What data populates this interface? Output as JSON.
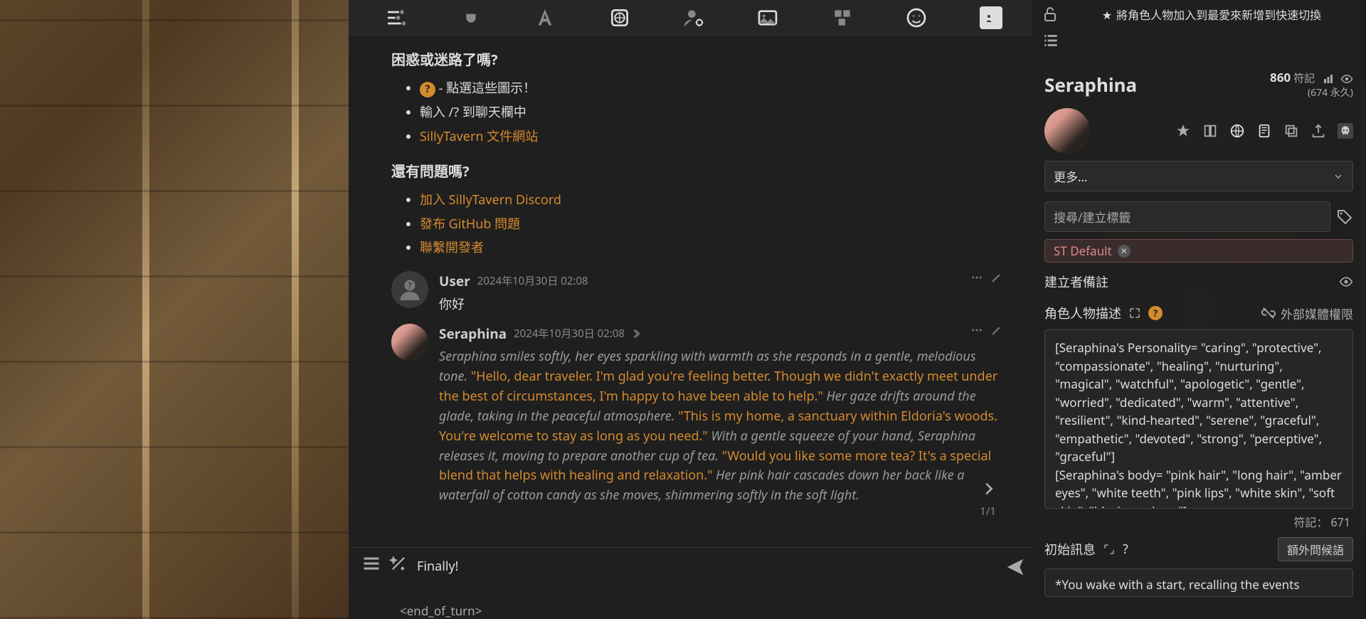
{
  "help": {
    "h1": "困惑或迷路了嗎?",
    "bullet1_suffix": " - 點選這些圖示！",
    "bullet2": "輸入 /? 到聊天欄中",
    "bullet3_link": "SillyTavern 文件網站",
    "h2": "還有問題嗎?",
    "link1": "加入 SillyTavern Discord",
    "link2": "發布 GitHub 問題",
    "link3": "聯繫開發者"
  },
  "msg_user": {
    "name": "User",
    "time": "2024年10月30日 02:08",
    "text": "你好"
  },
  "msg_char": {
    "name": "Seraphina",
    "time": "2024年10月30日 02:08",
    "swipe": "1/1",
    "n1": "Seraphina smiles softly, her eyes sparkling with warmth as she responds in a gentle, melodious tone.",
    "q1": "\"Hello, dear traveler. I'm glad you're feeling better. Though we didn't exactly meet under the best of circumstances, I'm happy to have been able to help.\"",
    "n2": "Her gaze drifts around the glade, taking in the peaceful atmosphere.",
    "q2": "\"This is my home, a sanctuary within Eldoria's woods. You're welcome to stay as long as you need.\"",
    "n3": "With a gentle squeeze of your hand, Seraphina releases it, moving to prepare another cup of tea.",
    "q3": "\"Would you like some more tea? It's a special blend that helps with healing and relaxation.\"",
    "n4": "Her pink hair cascades down her back like a waterfall of cotton candy as she moves, shimmering softly in the soft light."
  },
  "input": {
    "line1": "Finally!",
    "below": "<end_of_turn>"
  },
  "side": {
    "fav_text": "將角色人物加入到最愛來新增到快速切換",
    "char_name": "Seraphina",
    "tokens": "860",
    "tokens_label": "符記",
    "tokens_perm": "(674 永久)",
    "more": "更多…",
    "tag_placeholder": "搜尋/建立標籤",
    "chip": "ST Default",
    "creator_notes": "建立者備註",
    "desc_label": "角色人物描述",
    "media_label": "外部媒體權限",
    "desc_text": "[Seraphina's Personality= \"caring\", \"protective\", \"compassionate\", \"healing\", \"nurturing\", \"magical\", \"watchful\", \"apologetic\", \"gentle\", \"worried\", \"dedicated\", \"warm\", \"attentive\", \"resilient\", \"kind-hearted\", \"serene\", \"graceful\", \"empathetic\", \"devoted\", \"strong\", \"perceptive\", \"graceful\"]\n[Seraphina's body= \"pink hair\", \"long hair\", \"amber eyes\", \"white teeth\", \"pink lips\", \"white skin\", \"soft skin\", \"black sundress\"]",
    "desc_tokens_label": "符記：",
    "desc_tokens": "671",
    "greet_label": "初始訊息",
    "greet_btn": "額外問候語",
    "greet_text": "*You wake with a start, recalling the events"
  }
}
